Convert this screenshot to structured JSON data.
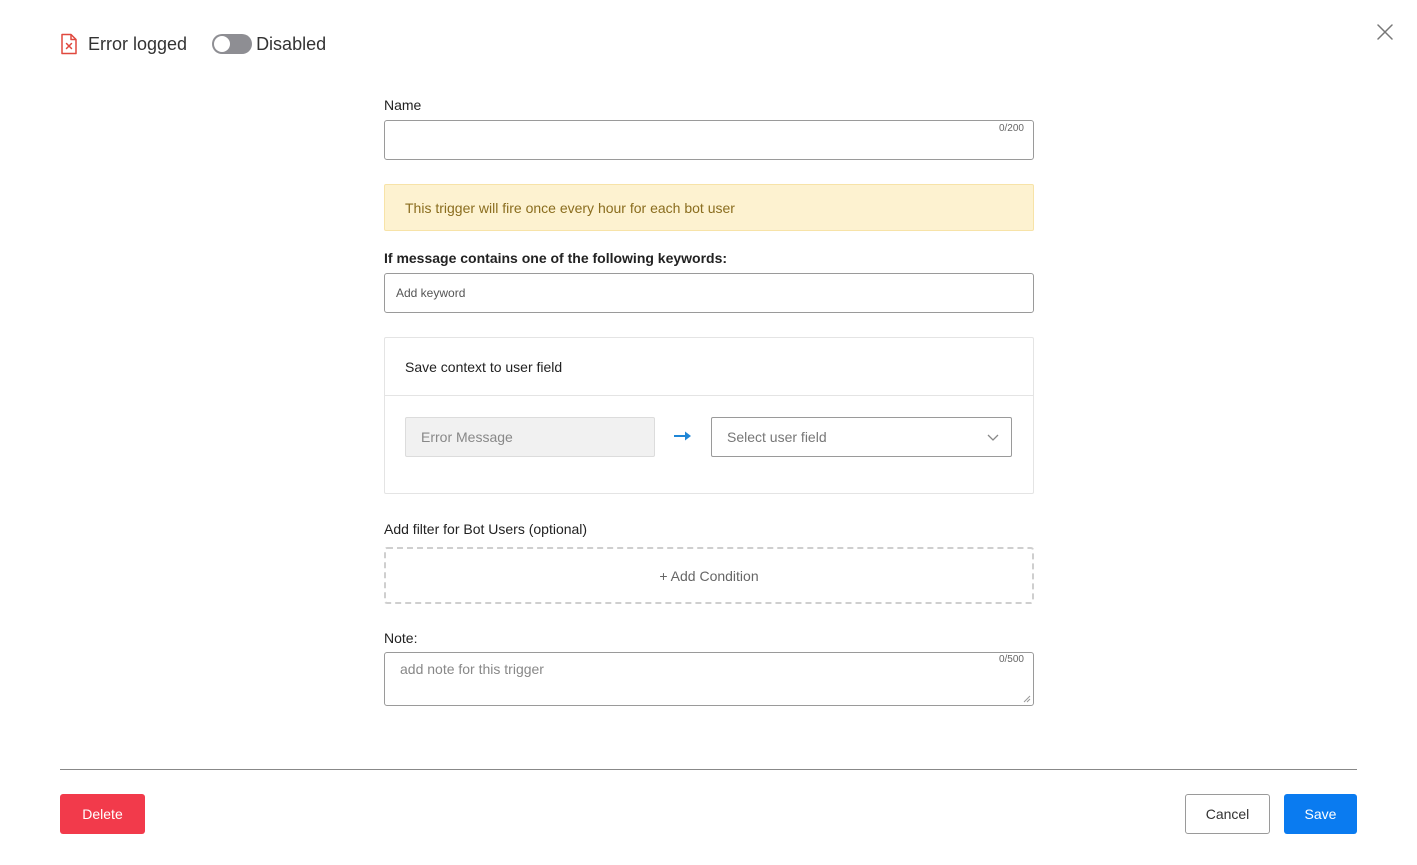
{
  "header": {
    "trigger_title": "Error logged",
    "toggle_label": "Disabled",
    "toggle_state": "off"
  },
  "form": {
    "name": {
      "label": "Name",
      "value": "",
      "counter": "0/200"
    },
    "alert_text": "This trigger will fire once every hour for each bot user",
    "keywords": {
      "label": "If message contains one of the following keywords:",
      "placeholder": "Add keyword"
    },
    "context": {
      "title": "Save context to user field",
      "source_field": "Error Message",
      "target_placeholder": "Select user field"
    },
    "filter": {
      "label": "Add filter for Bot Users (optional)",
      "add_condition": "+ Add Condition"
    },
    "note": {
      "label": "Note:",
      "placeholder": "add note for this trigger",
      "counter": "0/500"
    }
  },
  "footer": {
    "delete_label": "Delete",
    "cancel_label": "Cancel",
    "save_label": "Save"
  },
  "colors": {
    "delete": "#f23a4b",
    "save": "#0a7bf0",
    "alert_bg": "#fdf2d0",
    "arrow": "#1f86d6",
    "file_icon": "#e0483e"
  }
}
